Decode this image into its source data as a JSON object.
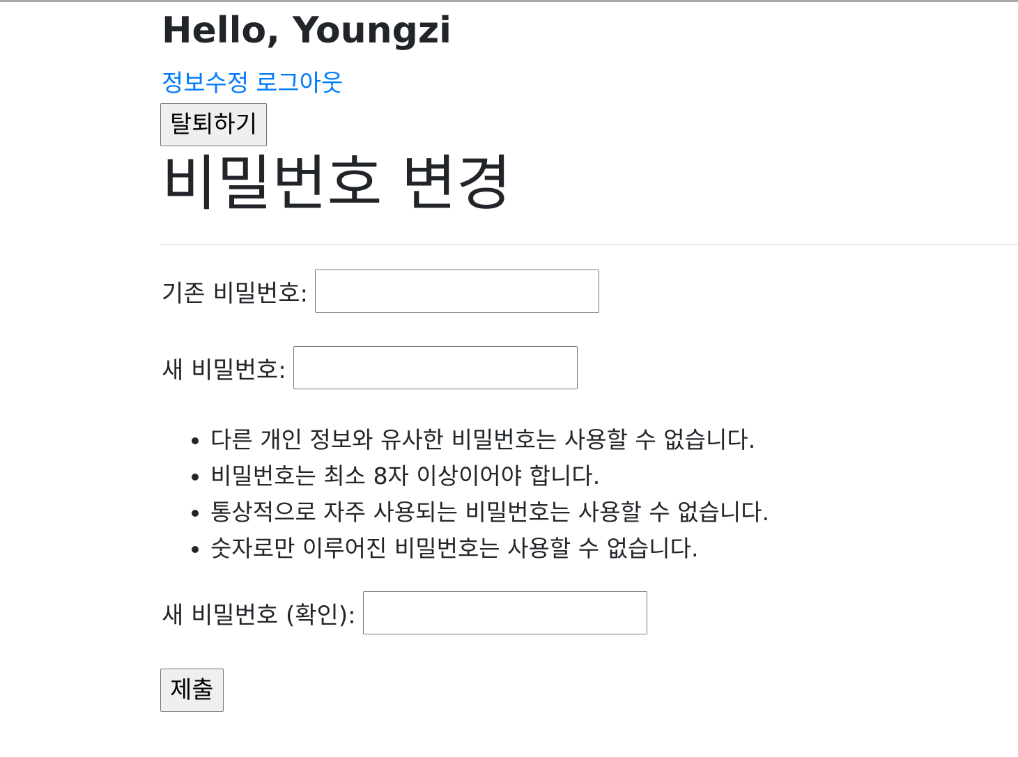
{
  "header": {
    "greeting": "Hello, Youngzi",
    "links": [
      {
        "label": "정보수정"
      },
      {
        "label": "로그아웃"
      }
    ],
    "withdraw_button": "탈퇴하기"
  },
  "form": {
    "title": "비밀번호 변경",
    "old_password_label": "기존 비밀번호:",
    "old_password_value": "",
    "new_password_label": "새 비밀번호:",
    "new_password_value": "",
    "help_items": [
      "다른 개인 정보와 유사한 비밀번호는 사용할 수 없습니다.",
      "비밀번호는 최소 8자 이상이어야 합니다.",
      "통상적으로 자주 사용되는 비밀번호는 사용할 수 없습니다.",
      "숫자로만 이루어진 비밀번호는 사용할 수 없습니다."
    ],
    "confirm_password_label": "새 비밀번호 (확인):",
    "confirm_password_value": "",
    "submit_button": "제출"
  },
  "colors": {
    "link": "#007bff",
    "text": "#212529",
    "button_bg": "#efefef"
  }
}
